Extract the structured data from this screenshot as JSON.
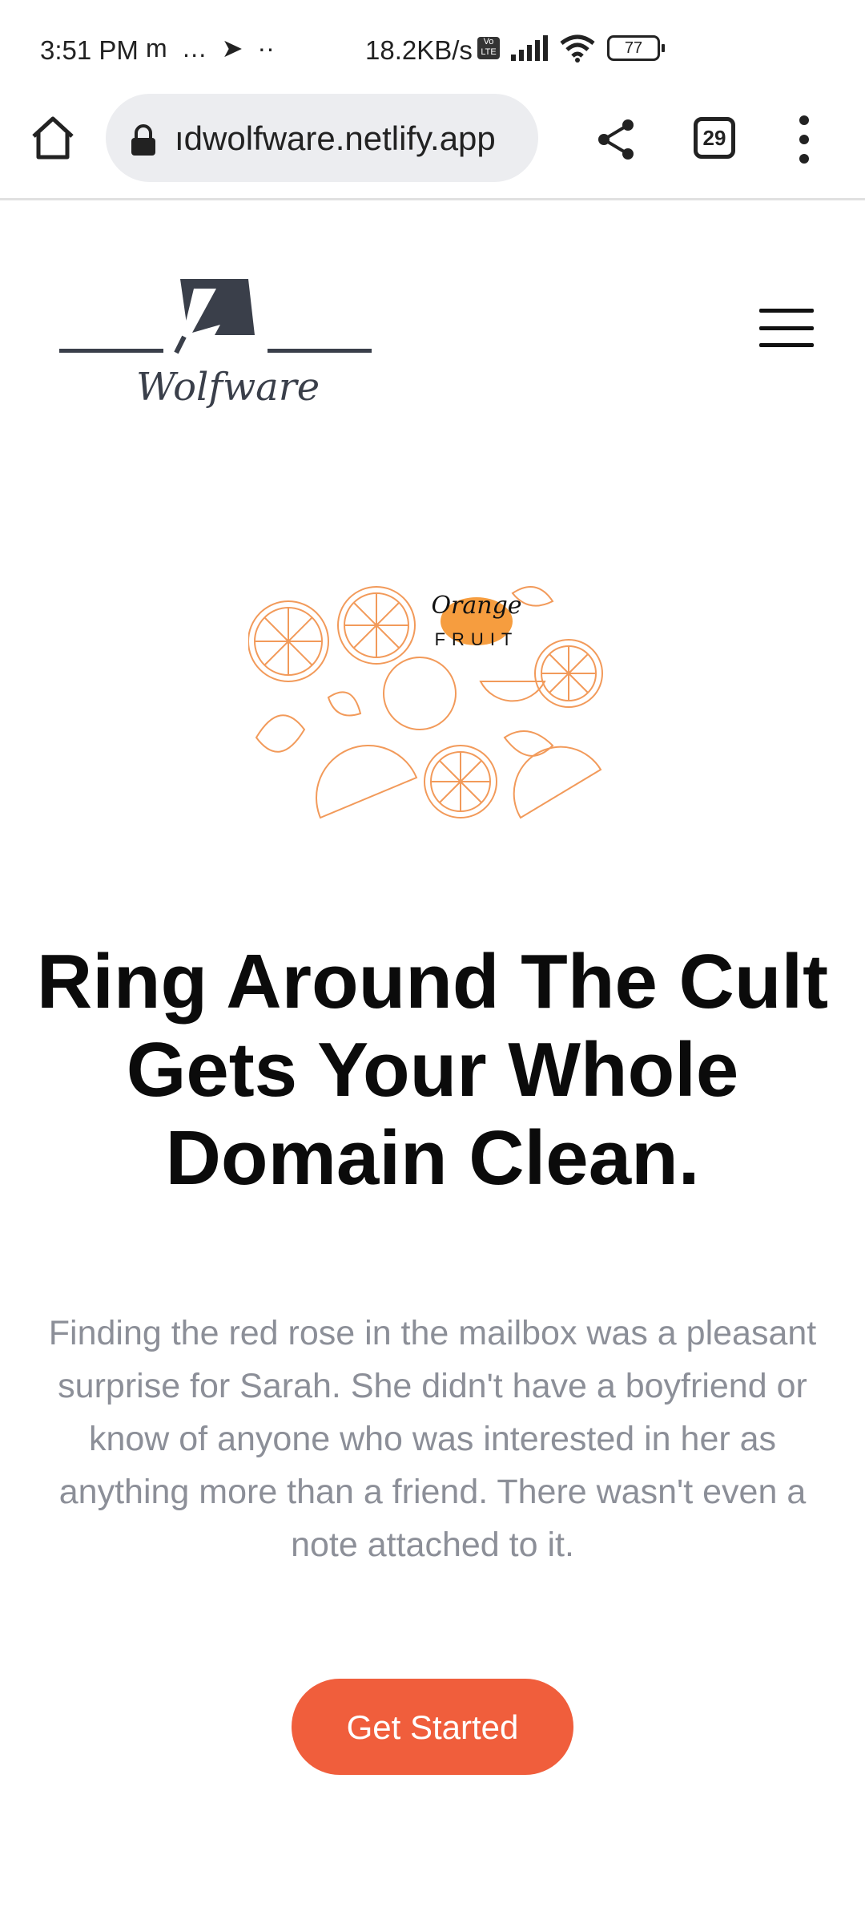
{
  "status_bar": {
    "time": "3:51 PM",
    "left_icons": [
      "m",
      "…",
      "➤",
      "··"
    ],
    "network_speed": "18.2KB/s",
    "volte_label": "Vo LTE",
    "battery_level": "77"
  },
  "browser": {
    "url": "ıdwolfware.netlify.app",
    "tab_count": "29"
  },
  "site": {
    "logo_text": "Wolfware",
    "hero_image_label": {
      "line1": "Orange",
      "line2": "FRUIT"
    },
    "headline": "Ring Around The Cult Gets Your Whole Domain Clean.",
    "paragraph": "Finding the red rose in the mailbox was a pleasant surprise for Sarah. She didn't have a boyfriend or know of anyone who was interested in her as anything more than a friend. There wasn't even a note attached to it.",
    "cta_label": "Get Started"
  },
  "colors": {
    "accent": "#f05e3c",
    "logo": "#3a3f4a",
    "paragraph": "#8c8f98",
    "orange_sketch": "#f29a5a"
  }
}
